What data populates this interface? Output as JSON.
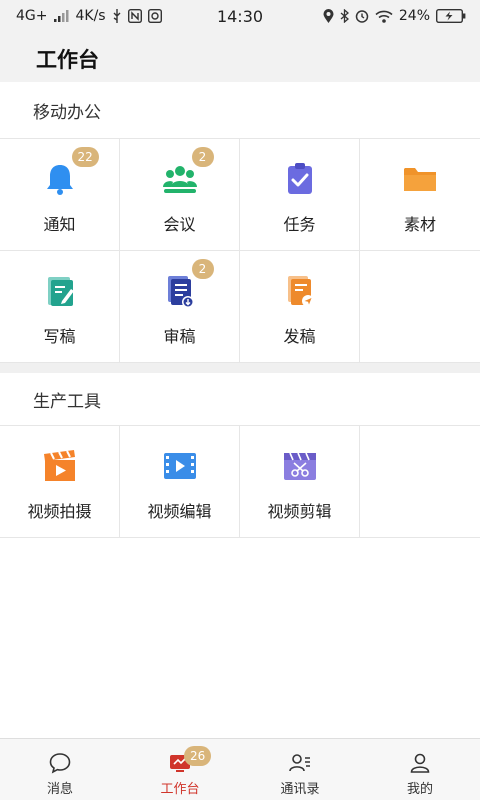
{
  "status_bar": {
    "network": "4G+",
    "speed": "4K/s",
    "time": "14:30",
    "battery": "24%"
  },
  "header": {
    "title": "工作台"
  },
  "sections": {
    "mobile_office": {
      "title": "移动办公",
      "items": [
        {
          "label": "通知",
          "icon": "bell-icon",
          "badge": "22"
        },
        {
          "label": "会议",
          "icon": "people-icon",
          "badge": "2"
        },
        {
          "label": "任务",
          "icon": "clipboard-check-icon",
          "badge": ""
        },
        {
          "label": "素材",
          "icon": "folder-icon",
          "badge": ""
        },
        {
          "label": "写稿",
          "icon": "write-doc-icon",
          "badge": ""
        },
        {
          "label": "审稿",
          "icon": "review-doc-icon",
          "badge": "2"
        },
        {
          "label": "发稿",
          "icon": "send-doc-icon",
          "badge": ""
        }
      ]
    },
    "production_tools": {
      "title": "生产工具",
      "items": [
        {
          "label": "视频拍摄",
          "icon": "video-shoot-icon"
        },
        {
          "label": "视频编辑",
          "icon": "video-edit-icon"
        },
        {
          "label": "视频剪辑",
          "icon": "video-cut-icon"
        }
      ]
    }
  },
  "tabbar": {
    "tabs": [
      {
        "label": "消息",
        "icon": "chat-bubble-icon",
        "badge": ""
      },
      {
        "label": "工作台",
        "icon": "workbench-icon",
        "badge": "26"
      },
      {
        "label": "通讯录",
        "icon": "contacts-icon",
        "badge": ""
      },
      {
        "label": "我的",
        "icon": "person-icon",
        "badge": ""
      }
    ]
  },
  "colors": {
    "accent_red": "#d0352b",
    "badge_gold": "#d9b57a",
    "bell_blue": "#2f8ff0",
    "meeting_green": "#22b36b",
    "task_purple": "#6b6be0",
    "folder_orange": "#f5a23c"
  }
}
